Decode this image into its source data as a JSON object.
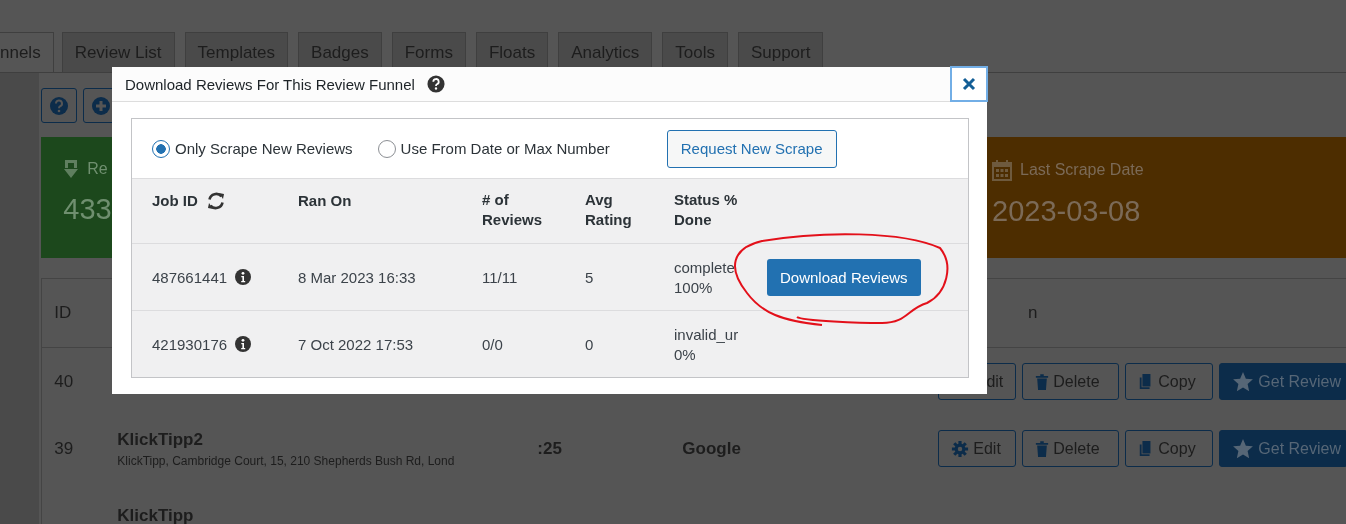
{
  "tabs": [
    {
      "label": "nnels",
      "selected": true
    },
    {
      "label": "Review List",
      "selected": false
    },
    {
      "label": "Templates",
      "selected": false
    },
    {
      "label": "Badges",
      "selected": false
    },
    {
      "label": "Forms",
      "selected": false
    },
    {
      "label": "Floats",
      "selected": false
    },
    {
      "label": "Analytics",
      "selected": false
    },
    {
      "label": "Tools",
      "selected": false
    },
    {
      "label": "Support",
      "selected": false
    }
  ],
  "stats": [
    {
      "kind": "count",
      "label": "Re",
      "value": "433"
    },
    {
      "kind": "date",
      "label": "Last Scrape Date",
      "value": "2023-03-08"
    }
  ],
  "table": {
    "columns": [
      "ID",
      "n"
    ],
    "rows": [
      {
        "id": "40",
        "actions": [
          {
            "kind": "plain",
            "label": "dit"
          },
          {
            "kind": "delete",
            "label": "Delete"
          },
          {
            "kind": "copy",
            "label": "Copy"
          },
          {
            "kind": "reviews",
            "label": "Get Review"
          }
        ]
      },
      {
        "id": "39",
        "name": "KlickTipp2",
        "address": "KlickTipp, Cambridge Court, 15, 210 Shepherds Bush Rd, Lond",
        "time": ":25",
        "source": "Google",
        "actions": [
          {
            "kind": "edit",
            "label": "Edit"
          },
          {
            "kind": "delete",
            "label": "Delete"
          },
          {
            "kind": "copy",
            "label": "Copy"
          },
          {
            "kind": "reviews",
            "label": "Get Review"
          }
        ]
      },
      {
        "name": "KlickTipp"
      }
    ]
  },
  "dialog": {
    "title": "Download Reviews For This Review Funnel",
    "options": [
      {
        "label": "Only Scrape New Reviews",
        "selected": true
      },
      {
        "label": "Use From Date or Max Number",
        "selected": false
      }
    ],
    "request_button": "Request New Scrape",
    "columns": [
      "Job ID",
      "Ran On",
      "# of Reviews",
      "Avg Rating",
      "Status % Done"
    ],
    "jobs": [
      {
        "job_id": "487661441",
        "ran_on": "8 Mar 2023 16:33",
        "reviews": "11/11",
        "rating": "5",
        "status": "complete",
        "done": "100%",
        "action": "Download Reviews"
      },
      {
        "job_id": "421930176",
        "ran_on": "7 Oct 2022 17:53",
        "reviews": "0/0",
        "rating": "0",
        "status": "invalid_ur",
        "done": "0%"
      }
    ]
  }
}
